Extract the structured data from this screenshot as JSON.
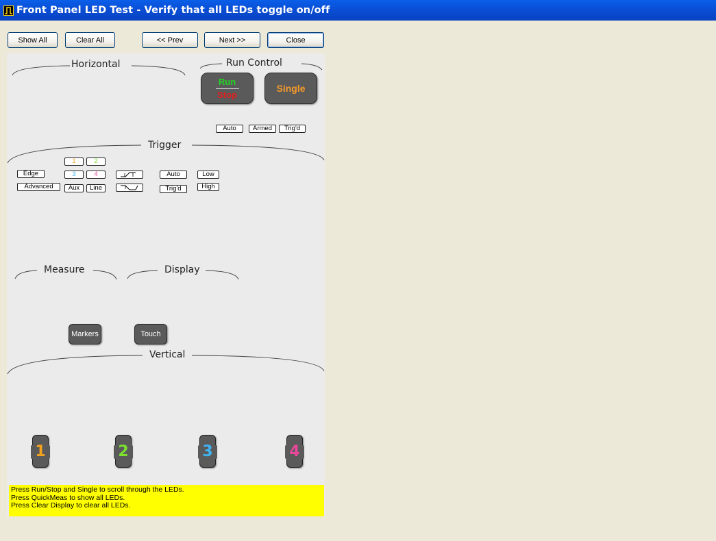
{
  "window": {
    "title": "Front Panel LED Test - Verify that all LEDs toggle on/off"
  },
  "toolbar": {
    "show_all": "Show All",
    "clear_all": "Clear All",
    "prev": "<< Prev",
    "next": "Next >>",
    "close": "Close"
  },
  "sections": {
    "horizontal": "Horizontal",
    "run_control": "Run Control",
    "trigger": "Trigger",
    "measure": "Measure",
    "display": "Display",
    "vertical": "Vertical"
  },
  "run_control": {
    "run": "Run",
    "stop": "Stop",
    "single": "Single",
    "leds": [
      "Auto",
      "Armed",
      "Trig'd"
    ]
  },
  "trigger": {
    "edge": "Edge",
    "advanced": "Advanced",
    "ch1": "1",
    "ch2": "2",
    "ch3": "3",
    "ch4": "4",
    "aux": "Aux",
    "line": "Line",
    "mode_auto": "Auto",
    "mode_trigd": "Trig'd",
    "low": "Low",
    "high": "High"
  },
  "keys": {
    "markers": "Markers",
    "touch": "Touch"
  },
  "channels": [
    "1",
    "2",
    "3",
    "4"
  ],
  "colors": {
    "ch1": "#F5A21F",
    "ch2": "#7BE02F",
    "ch3": "#3FB4F0",
    "ch4": "#E8479A",
    "run": "#22D622",
    "stop": "#E11E1E",
    "single": "#F59A2A",
    "help_bg": "#FFFF00",
    "panel_bg": "#EBEBEB"
  },
  "help": [
    "Press Run/Stop and Single to scroll through the LEDs.",
    "Press QuickMeas to show all LEDs.",
    "Press Clear Display to clear all LEDs."
  ]
}
